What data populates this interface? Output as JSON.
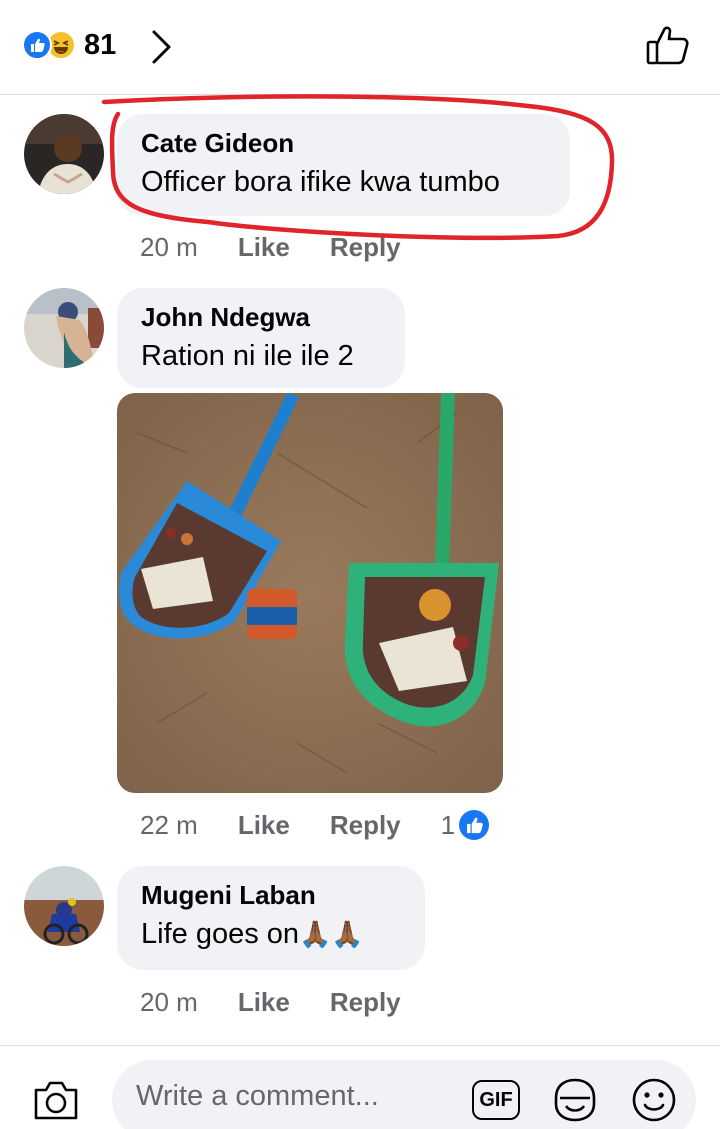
{
  "header": {
    "reaction_icons": [
      "like-icon",
      "haha-icon"
    ],
    "reaction_count": "81"
  },
  "comments": [
    {
      "author": "Cate Gideon",
      "text": "Officer bora ifike kwa tumbo",
      "time": "20 m",
      "like_label": "Like",
      "reply_label": "Reply"
    },
    {
      "author": "John Ndegwa",
      "text": "Ration ni ile ile 2",
      "time": "22 m",
      "like_label": "Like",
      "reply_label": "Reply",
      "reaction_count": "1"
    },
    {
      "author": "Mugeni Laban",
      "text": "Life goes on",
      "emoji": "🙏🏾🙏🏾",
      "time": "20 m",
      "like_label": "Like",
      "reply_label": "Reply"
    }
  ],
  "composer": {
    "placeholder": "Write a comment...",
    "gif_label": "GIF"
  },
  "colors": {
    "accent": "#1877f2",
    "bubble": "#f0f2f5",
    "muted": "#65676b",
    "annotation": "#e0242a"
  }
}
